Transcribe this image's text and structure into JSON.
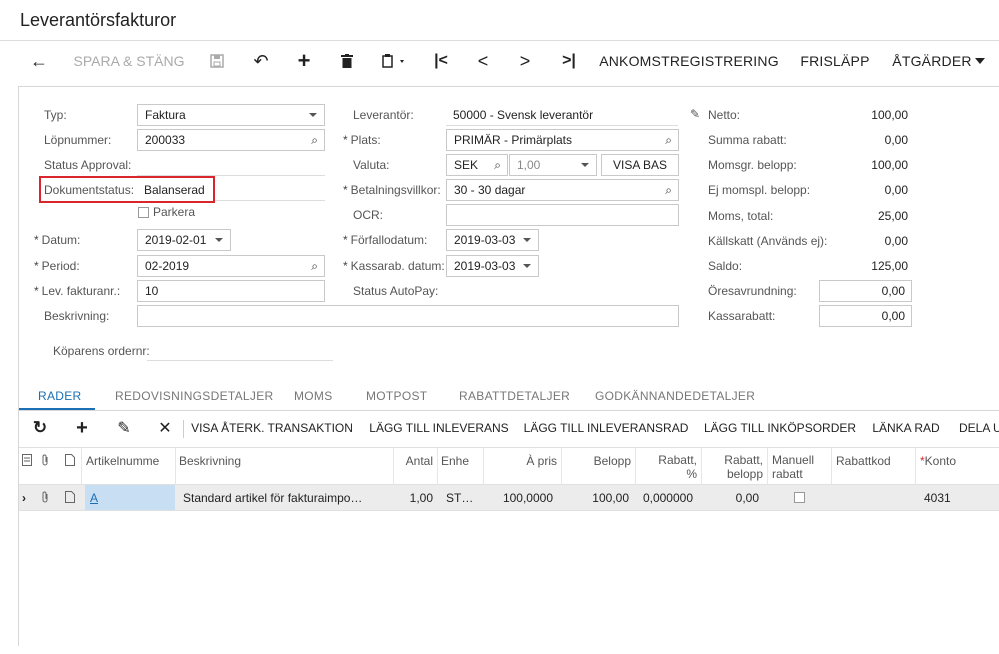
{
  "page": {
    "title": "Leverantörsfakturor"
  },
  "toolbar": {
    "back": "←",
    "save_close": "SPARA & STÄNG",
    "save": "💾",
    "undo": "↶",
    "add": "+",
    "delete": "🗑",
    "copy": "⎘",
    "first": "|<",
    "prev": "<",
    "next": ">",
    "last": ">|",
    "arrival": "ANKOMSTREGISTRERING",
    "release": "FRISLÄPP",
    "actions": "ÅTGÄRDER"
  },
  "form": {
    "typ_label": "Typ:",
    "typ_value": "Faktura",
    "lop_label": "Löpnummer:",
    "lop_value": "200033",
    "approval_label": "Status Approval:",
    "dokstatus_label": "Dokumentstatus:",
    "dokstatus_value": "Balanserad",
    "parkera_label": "Parkera",
    "datum_label": "Datum:",
    "datum_value": "2019-02-01",
    "period_label": "Period:",
    "period_value": "02-2019",
    "levfaktnr_label": "Lev. fakturanr.:",
    "levfaktnr_value": "10",
    "beskrivning_label": "Beskrivning:",
    "beskrivning_value": "",
    "koparens_label": "Köparens ordernr:",
    "leverantor_label": "Leverantör:",
    "leverantor_value": "50000 - Svensk leverantör",
    "plats_label": "Plats:",
    "plats_value": "PRIMÄR - Primärplats",
    "valuta_label": "Valuta:",
    "valuta_value": "SEK",
    "kurs_value": "1,00",
    "visa_bas": "VISA BAS",
    "betvillkor_label": "Betalningsvillkor:",
    "betvillkor_value": "30 - 30 dagar",
    "ocr_label": "OCR:",
    "ocr_value": "",
    "forfall_label": "Förfallodatum:",
    "forfall_value": "2019-03-03",
    "kassarab_label": "Kassarab. datum:",
    "kassarab_value": "2019-03-03",
    "autopay_label": "Status AutoPay:"
  },
  "totals": {
    "netto_label": "Netto:",
    "netto": "100,00",
    "summa_rabatt_label": "Summa rabatt:",
    "summa_rabatt": "0,00",
    "momsgr_label": "Momsgr. belopp:",
    "momsgr": "100,00",
    "ejmoms_label": "Ej momspl. belopp:",
    "ejmoms": "0,00",
    "moms_label": "Moms, total:",
    "moms": "25,00",
    "kallskatt_label": "Källskatt (Används ej):",
    "kallskatt": "0,00",
    "saldo_label": "Saldo:",
    "saldo": "125,00",
    "oresavr_label": "Öresavrundning:",
    "oresavr": "0,00",
    "kassarabatt_label": "Kassarabatt:",
    "kassarabatt": "0,00"
  },
  "tabs": [
    "RADER",
    "REDOVISNINGSDETALJER",
    "MOMS",
    "MOTPOST",
    "RABATTDETALJER",
    "GODKÄNNANDEDETALJER"
  ],
  "grid_toolbar": {
    "refresh": "↻",
    "add": "+",
    "edit": "✎",
    "remove": "✕",
    "visa": "VISA ÅTERK. TRANSAKTION",
    "lagg_inlev": "LÄGG TILL INLEVERANS",
    "lagg_inlevrad": "LÄGG TILL INLEVERANSRAD",
    "lagg_ink": "LÄGG TILL INKÖPSORDER",
    "lanka": "LÄNKA RAD",
    "dela": "DELA U"
  },
  "grid": {
    "headers": {
      "artikel": "Artikelnumme",
      "beskrivning": "Beskrivning",
      "antal": "Antal",
      "enhet": "Enhe",
      "apris": "À pris",
      "belopp": "Belopp",
      "rabatt_pct_1": "Rabatt,",
      "rabatt_pct_2": "%",
      "rabatt_bel_1": "Rabatt,",
      "rabatt_bel_2": "belopp",
      "manuell_1": "Manuell",
      "manuell_2": "rabatt",
      "rabattkod": "Rabattkod",
      "konto": "Konto"
    },
    "row": {
      "artikel": "A",
      "beskrivning": "Standard artikel för fakturaimpo…",
      "antal": "1,00",
      "enhet": "ST…",
      "apris": "100,0000",
      "belopp": "100,00",
      "rabatt_pct": "0,000000",
      "rabatt_bel": "0,00",
      "konto": "4031"
    }
  }
}
